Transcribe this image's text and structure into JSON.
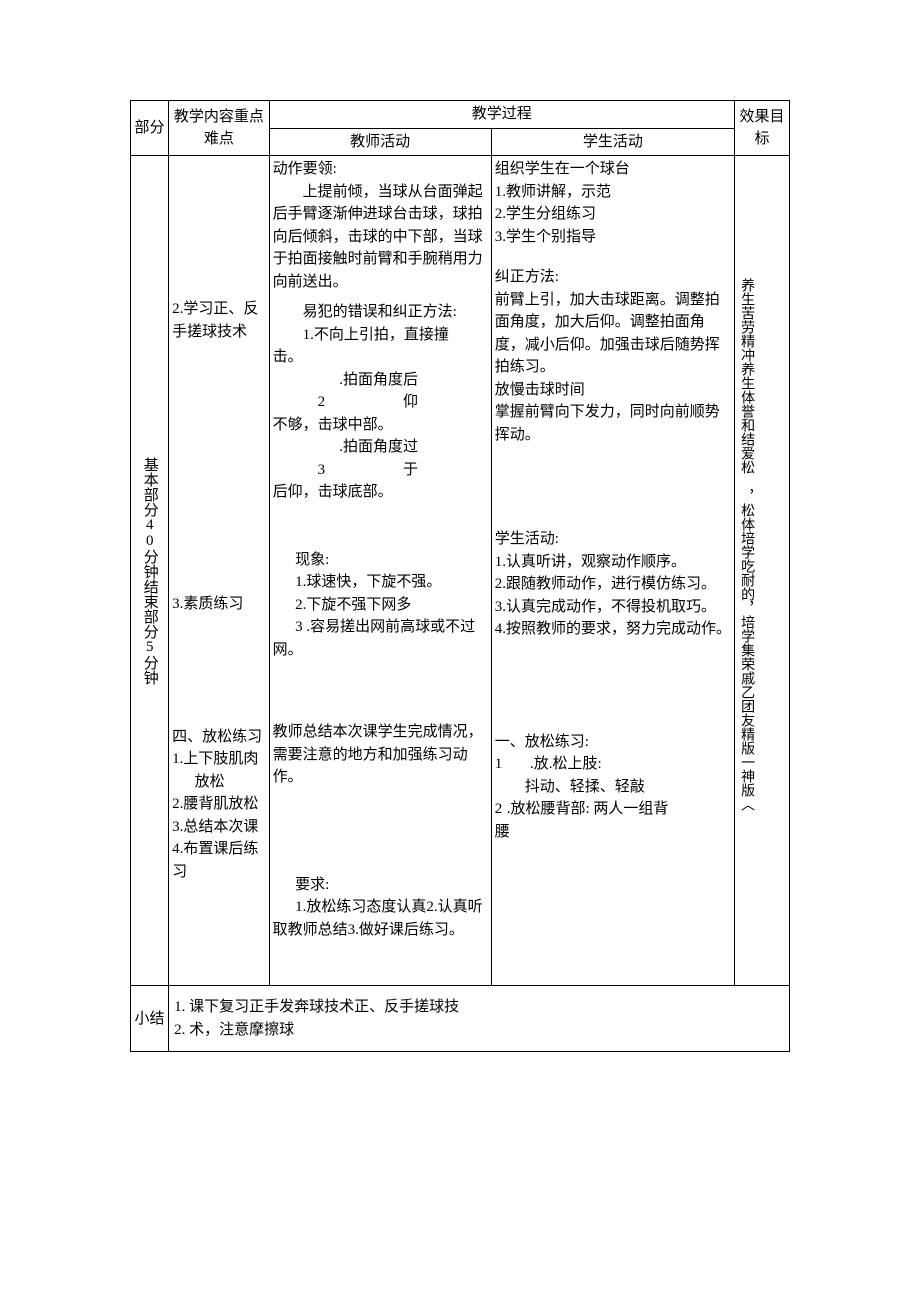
{
  "headers": {
    "section": "部分",
    "content": "教学内容重点难点",
    "process": "教学过程",
    "teacher": "教师活动",
    "student": "学生活动",
    "effect": "效果目标"
  },
  "section_label": "基本部分40分钟结束部分5分钟",
  "content_col": {
    "item2": "2.学习正、反手搓球技术",
    "item3": "3.素质练习",
    "item4_title": "四、放松练习",
    "item4_1": "1.上下肢肌肉",
    "item4_1b": "放松",
    "item4_2": "2.腰背肌放松",
    "item4_3": "3.总结本次课",
    "item4_4": "4.布置课后练习"
  },
  "teacher_col": {
    "a_title": "动作要领:",
    "a_body1": "上提前倾，当球从台面弹起后手臂逐渐伸进球台击球，球拍向后倾斜，击球的中下部，当球于拍面接触时前臂和手腕稍用力向前送出。",
    "a_title2": "易犯的错误和纠正方法:",
    "a_err1": "1.不向上引拍，直接撞",
    "a_err1b": "击。",
    "a_err2n": "2",
    "a_err2": ".拍面角度后仰",
    "a_err2b": "不够，击球中部。",
    "a_err3n": "3",
    "a_err3": ".拍面角度过于",
    "a_err3b": "后仰，击球底部。",
    "b_title": "现象:",
    "b_1": "1.球速快，下旋不强。",
    "b_2": "2.下旋不强下网多",
    "b_3": "3 .容易搓出网前高球或不过网。",
    "c_body": "教师总结本次课学生完成情况，需要注意的地方和加强练习动作。",
    "d_title": "要求:",
    "d_body": "1.放松练习态度认真2.认真听取教师总结3.做好课后练习。"
  },
  "student_col": {
    "a_org": "组织学生在一个球台",
    "a_1": "1.教师讲解，示范",
    "a_2": "2.学生分组练习",
    "a_3": "3.学生个别指导",
    "a_fix_title": "纠正方法:",
    "a_fix_body": "前臂上引，加大击球距离。调整拍面角度，加大后仰。调整拍面角度，减小后仰。加强击球后随势挥拍练习。",
    "a_fix_slow": "放慢击球时间",
    "a_fix_grip": "掌握前臂向下发力，同时向前顺势挥动。",
    "b_title": "学生活动:",
    "b_1": "1.认真听讲，观察动作顺序。",
    "b_2": "2.跟随教师动作，进行模仿练习。",
    "b_3": "3.认真完成动作，不得投机取巧。",
    "b_4": "4.按照教师的要求，努力完成动作。",
    "c_title": "一、放松练习:",
    "c_1n": "1",
    "c_1": ".放.松上肢:",
    "c_1b": "抖动、轻揉、轻敲",
    "c_2n": "2",
    "c_2": ".放松腰背部: 两人一组背",
    "c_2b": "腰"
  },
  "effect_text_1": "养生苦劳精冲养生体誉和结爱松",
  "effect_text_2": "，松体培学吃耐的，培学集荣戚乙团友精版一神版︿",
  "summary": {
    "label": "小结",
    "line1": "1.   课下复习正手发奔球技术正、反手搓球技",
    "line2": "2.   术，注意摩擦球"
  }
}
